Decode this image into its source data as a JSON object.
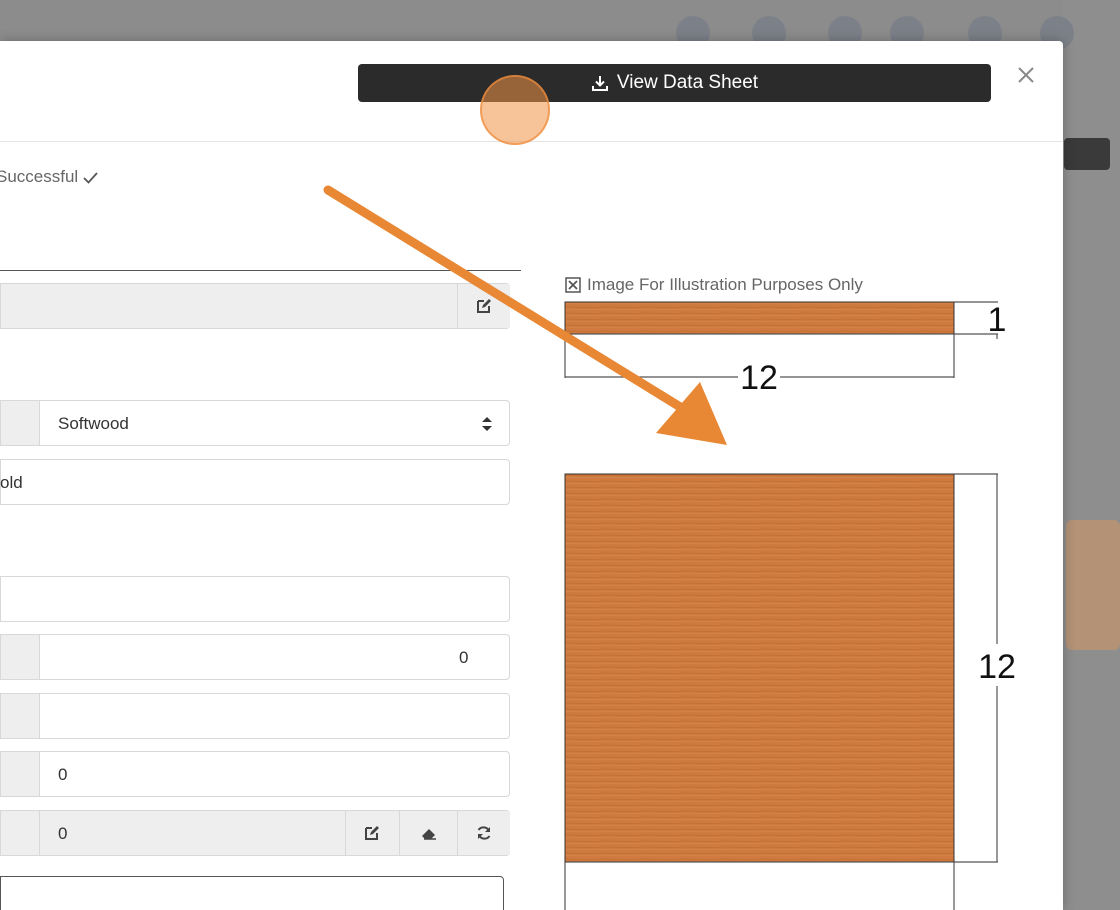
{
  "header": {
    "datasheet_button": "View Data Sheet",
    "download_icon": "download-icon",
    "close_icon": "close-icon"
  },
  "status": {
    "text": "Successful",
    "icon": "check-icon"
  },
  "form": {
    "material_select": "Softwood",
    "name_field": "old",
    "field_blank_1": "",
    "field_right_value": "0",
    "field_blank_2": "",
    "field_zero": "0",
    "field_zero_actions": "0"
  },
  "illustration": {
    "label": "Image For Illustration Purposes Only",
    "icon": "expand-icon",
    "top_view_thickness": "1",
    "top_view_width": "12",
    "front_view_height": "12"
  },
  "colors": {
    "wood": "#cf7a3e",
    "arrow": "#e88834",
    "button_dark": "#2b2b2b"
  }
}
